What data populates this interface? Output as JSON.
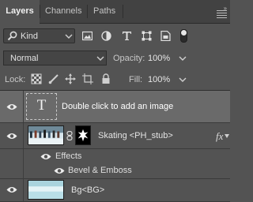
{
  "tabs": {
    "layers": "Layers",
    "channels": "Channels",
    "paths": "Paths",
    "collapse": "››"
  },
  "filter": {
    "kind_label": "Kind",
    "filter_icons": [
      "pixel-layer-filter-icon",
      "adjustment-layer-filter-icon",
      "type-layer-filter-icon",
      "shape-layer-filter-icon",
      "smart-object-filter-icon",
      "filter-toggle"
    ]
  },
  "blending": {
    "mode": "Normal",
    "opacity_label": "Opacity:",
    "opacity_value": "100%"
  },
  "lock": {
    "label": "Lock:",
    "fill_label": "Fill:",
    "fill_value": "100%"
  },
  "layers": [
    {
      "name": "Double click  to add an image",
      "thumb_glyph": "T",
      "selected": true,
      "visible": true
    },
    {
      "name": "Skating <PH_stub>",
      "fx": "fx",
      "visible": true,
      "effects_label": "Effects",
      "effect": "Bevel & Emboss"
    },
    {
      "name": "Bg<BG>",
      "visible": true
    }
  ],
  "colors": {
    "panel_bg": "#535353",
    "tab_bar_bg": "#424242",
    "selected_layer_bg": "#6a6a6a"
  }
}
